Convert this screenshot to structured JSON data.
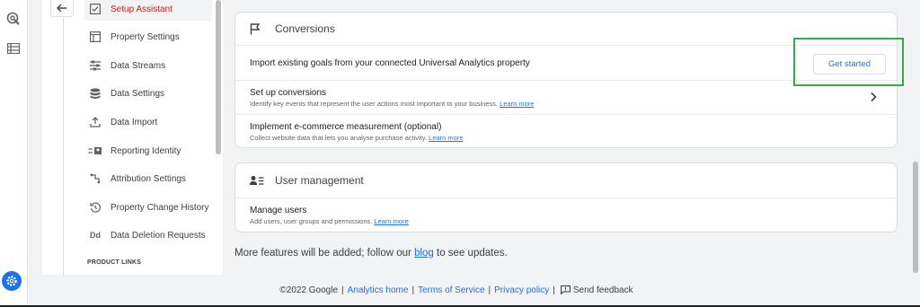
{
  "nav": {
    "items": [
      {
        "label": "Setup Assistant",
        "icon": "checkbox-icon",
        "active": true
      },
      {
        "label": "Property Settings",
        "icon": "property-icon"
      },
      {
        "label": "Data Streams",
        "icon": "streams-icon"
      },
      {
        "label": "Data Settings",
        "icon": "database-icon"
      },
      {
        "label": "Data Import",
        "icon": "upload-icon"
      },
      {
        "label": "Reporting Identity",
        "icon": "identity-icon"
      },
      {
        "label": "Attribution Settings",
        "icon": "attribution-icon"
      },
      {
        "label": "Property Change History",
        "icon": "history-icon"
      },
      {
        "label": "Data Deletion Requests",
        "icon": "deletion-icon",
        "icon_text": "Dd"
      }
    ],
    "product_links_label": "PRODUCT LINKS"
  },
  "conversions": {
    "title": "Conversions",
    "import_text": "Import existing goals from your connected Universal Analytics property",
    "get_started": "Get started",
    "setup_title": "Set up conversions",
    "setup_sub": "Identify key events that represent the user actions most important to your business.",
    "ecom_title": "Implement e-commerce measurement (optional)",
    "ecom_sub": "Collect website data that lets you analyse purchase activity."
  },
  "learn_more": "Learn more",
  "user_management": {
    "title": "User management",
    "manage_title": "Manage users",
    "manage_sub": "Add users, user groups and permissions."
  },
  "more_features": {
    "before": "More features will be added; follow our ",
    "link": "blog",
    "after": " to see updates."
  },
  "footer": {
    "copyright": "©2022 Google",
    "analytics_home": "Analytics home",
    "terms": "Terms of Service",
    "privacy": "Privacy policy",
    "feedback": "Send feedback"
  },
  "colors": {
    "accent": "#1a73e8",
    "active_nav": "#c5221f",
    "highlight": "#34a853"
  }
}
